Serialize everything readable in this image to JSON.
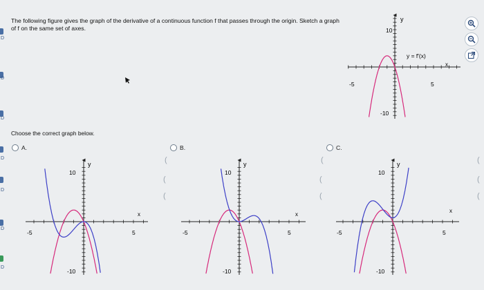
{
  "question": {
    "text": "The following figure gives the graph of the derivative of a continuous function f that passes through the origin. Sketch a graph of f on the same set of axes."
  },
  "prompt": "Choose the correct graph below.",
  "main_graph": {
    "label_y": "y",
    "label_x": "x",
    "tick_x_neg": "-5",
    "tick_x_pos": "5",
    "tick_y_pos": "10",
    "tick_y_neg": "-10",
    "curve_label": "y = f′(x)"
  },
  "options": [
    {
      "letter": "A.",
      "label_y": "y",
      "label_x": "x",
      "tick_x_neg": "-5",
      "tick_x_pos": "5",
      "tick_y_pos": "10",
      "tick_y_neg": "-10"
    },
    {
      "letter": "B.",
      "label_y": "y",
      "label_x": "x",
      "tick_x_neg": "-5",
      "tick_x_pos": "5",
      "tick_y_pos": "10",
      "tick_y_neg": "-10"
    },
    {
      "letter": "C.",
      "label_y": "y",
      "label_x": "x",
      "tick_x_neg": "-5",
      "tick_x_pos": "5",
      "tick_y_pos": "10",
      "tick_y_neg": "-10"
    }
  ],
  "colors": {
    "derivative": "#d6287a",
    "antiderivative": "#3c3fc7",
    "axis": "#222222",
    "radio_border": "#6d7b8a"
  },
  "toolbar": {
    "icons": [
      "zoom-in-icon",
      "zoom-out-icon",
      "popout-icon"
    ]
  }
}
